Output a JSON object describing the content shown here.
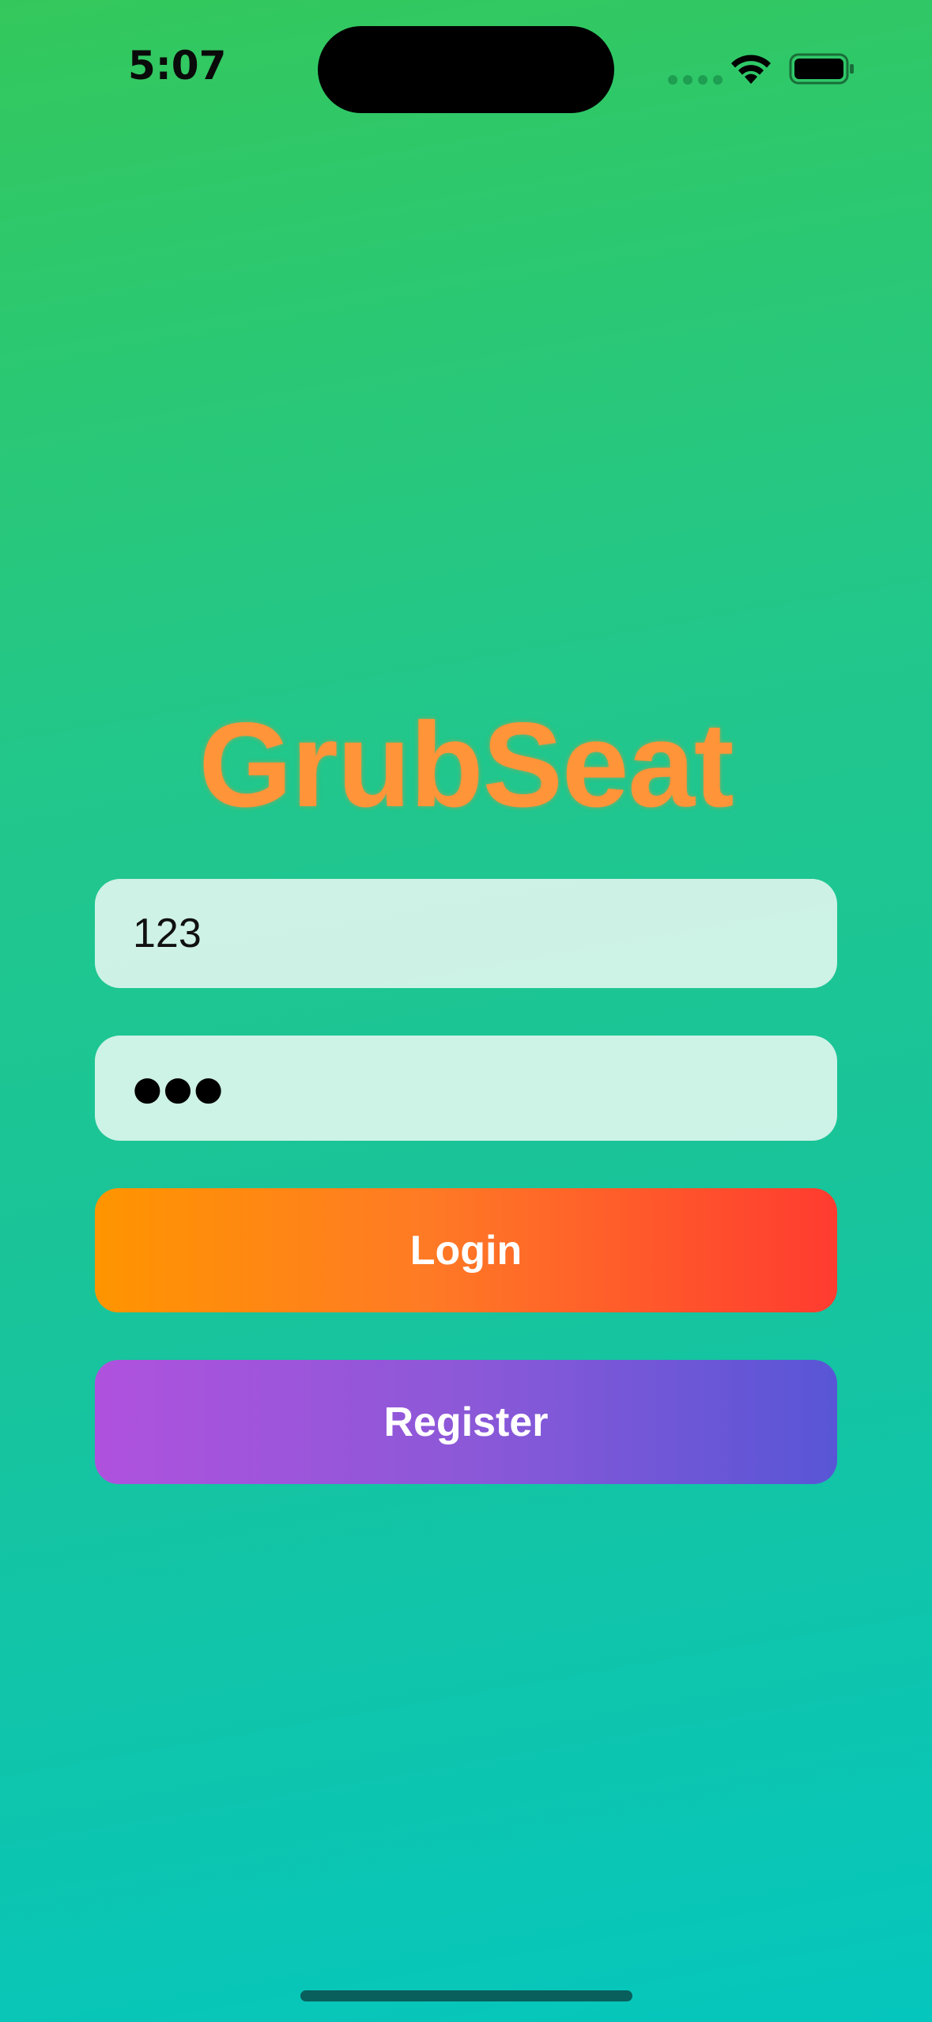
{
  "status_bar": {
    "time": "5:07",
    "icons": [
      "signal-dots-icon",
      "wifi-icon",
      "battery-icon"
    ]
  },
  "app": {
    "brand_name": "GrubSeat"
  },
  "login_form": {
    "username_value": "123",
    "password_mask": "●●●",
    "login_label": "Login",
    "register_label": "Register"
  },
  "colors": {
    "brand": "#ff9439",
    "background_top": "#34c85c",
    "background_bottom": "#05c6bd",
    "login_gradient": [
      "#ff9500",
      "#ff3b30"
    ],
    "register_gradient": [
      "#af52de",
      "#5856d6"
    ]
  }
}
